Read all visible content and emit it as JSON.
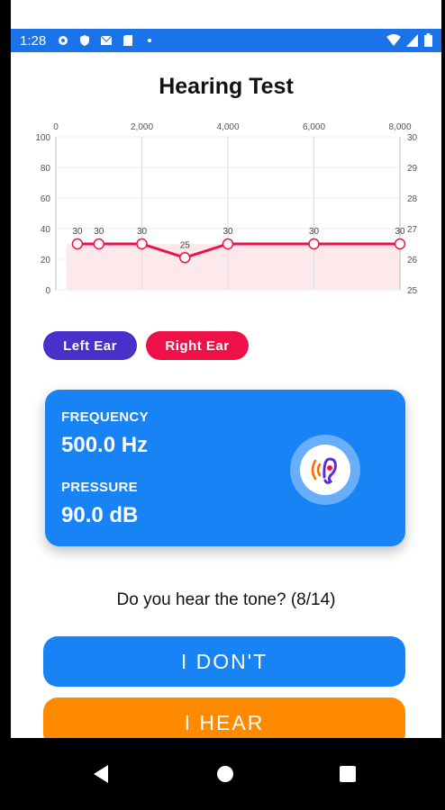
{
  "status": {
    "time": "1:28",
    "icons": [
      "gear-icon",
      "shield-icon",
      "mail-icon",
      "sdcard-icon",
      "dot-icon"
    ],
    "right_icons": [
      "wifi-icon",
      "signal-icon",
      "battery-icon"
    ]
  },
  "header": {
    "title": "Hearing Test"
  },
  "chart_data": {
    "type": "line",
    "x_top_ticks": [
      "0",
      "2,000",
      "4,000",
      "6,000",
      "8,000"
    ],
    "x_ticks": [
      0,
      2000,
      4000,
      6000,
      8000
    ],
    "y_left_ticks": [
      0,
      20,
      40,
      60,
      80,
      100
    ],
    "y_right_ticks": [
      25,
      26,
      27,
      28,
      29,
      30
    ],
    "ylim_left": [
      0,
      100
    ],
    "ylim_right": [
      25,
      30
    ],
    "xlim": [
      0,
      8000
    ],
    "series": [
      {
        "color": "#ee1148",
        "x": [
          500,
          1000,
          2000,
          3000,
          4000,
          6000,
          8000
        ],
        "y": [
          30,
          30,
          30,
          25,
          30,
          30,
          30
        ]
      }
    ],
    "data_labels": [
      "30",
      "30",
      "30",
      "25",
      "30",
      "30",
      "30"
    ],
    "grid": true
  },
  "ears": {
    "left_label": "Left Ear",
    "right_label": "Right Ear"
  },
  "card": {
    "frequency_label": "FREQUENCY",
    "frequency_value": "500.0 Hz",
    "pressure_label": "PRESSURE",
    "pressure_value": "90.0 dB",
    "icon": "ear-icon"
  },
  "prompt": {
    "question": "Do you hear the tone? (8/14)"
  },
  "actions": {
    "dont_label": "I DON'T",
    "hear_label": "I HEAR"
  },
  "nav": {
    "icons": [
      "back-icon",
      "home-icon",
      "recents-icon"
    ]
  }
}
